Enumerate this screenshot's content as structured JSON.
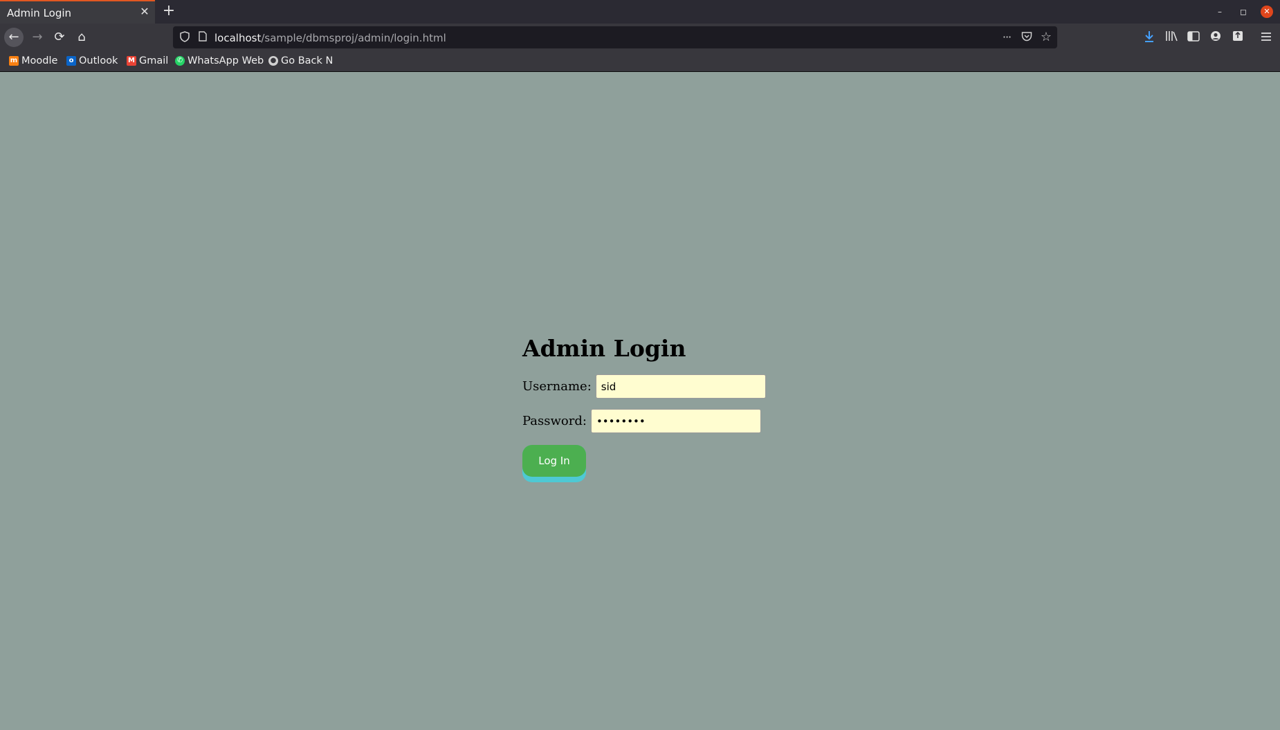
{
  "browser": {
    "tab": {
      "title": "Admin Login",
      "close_glyph": "✕"
    },
    "new_tab_glyph": "+",
    "window_controls": {
      "minimize": "–",
      "restore": "◻",
      "close": "✕"
    },
    "nav": {
      "back": "←",
      "forward": "→",
      "reload": "⟳",
      "home": "⌂"
    },
    "url": {
      "host": "localhost",
      "path": "/sample/dbmsproj/admin/login.html"
    },
    "url_icons": {
      "shield": "shield-icon",
      "page": "page-icon",
      "more": "···",
      "pocket": "pocket-icon",
      "star": "☆"
    },
    "toolbar_icons": [
      "download-icon",
      "library-icon",
      "sidebar-icon",
      "account-icon",
      "extension-icon",
      "menu-icon"
    ],
    "bookmarks": [
      {
        "label": "Moodle",
        "icon": "moodle-icon",
        "color": "#f98012"
      },
      {
        "label": "Outlook",
        "icon": "outlook-icon",
        "color": "#0a64c8"
      },
      {
        "label": "Gmail",
        "icon": "gmail-icon",
        "color": "#ea4335"
      },
      {
        "label": "WhatsApp Web",
        "icon": "whatsapp-icon",
        "color": "#25d366"
      },
      {
        "label": "Go Back N",
        "icon": "github-icon",
        "color": "#d0d0d0"
      }
    ]
  },
  "page": {
    "heading": "Admin Login",
    "username": {
      "label": "Username:",
      "value": "sid"
    },
    "password": {
      "label": "Password:",
      "value": "••••••••"
    },
    "submit_label": "Log In"
  },
  "colors": {
    "page_background": "#8fa09b",
    "input_background": "#fffdd0",
    "button": "#4caf50",
    "button_shadow": "#4ec9d4",
    "tab_accent": "#e25822"
  }
}
